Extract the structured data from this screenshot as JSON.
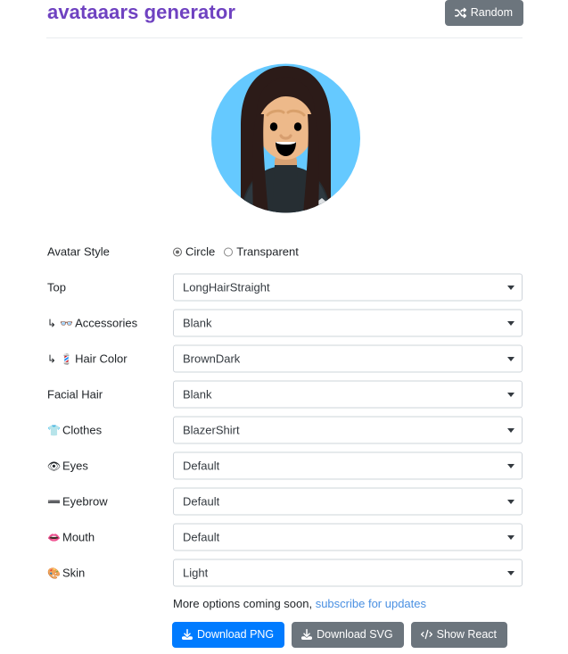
{
  "header": {
    "title": "avataaars generator",
    "random_label": "Random",
    "random_icon": "shuffle-icon"
  },
  "avatar": {
    "style": "Circle",
    "background_color": "#65c9ff",
    "skin_color": "#edb98a",
    "hair_color": "#2c1b18",
    "clothes_color": "#262e33",
    "mouth_color": "#000000",
    "eye_color": "#000000"
  },
  "form": {
    "avatar_style": {
      "label": "Avatar Style",
      "options": [
        "Circle",
        "Transparent"
      ],
      "selected": "Circle"
    },
    "fields": [
      {
        "label": "Top",
        "icon": "",
        "sub": false,
        "value": "LongHairStraight"
      },
      {
        "label": "Accessories",
        "icon": "👓",
        "icon_name": "glasses-icon",
        "sub": true,
        "value": "Blank"
      },
      {
        "label": "Hair Color",
        "icon": "💈",
        "icon_name": "hair-color-icon",
        "sub": true,
        "value": "BrownDark"
      },
      {
        "label": "Facial Hair",
        "icon": "",
        "sub": false,
        "value": "Blank"
      },
      {
        "label": "Clothes",
        "icon": "👕",
        "icon_name": "shirt-icon",
        "sub": false,
        "value": "BlazerShirt"
      },
      {
        "label": "Eyes",
        "icon": "👁",
        "icon_name": "eye-icon",
        "sub": false,
        "value": "Default"
      },
      {
        "label": "Eyebrow",
        "icon": "➖",
        "icon_name": "eyebrow-icon",
        "sub": false,
        "value": "Default"
      },
      {
        "label": "Mouth",
        "icon": "👄",
        "icon_name": "mouth-icon",
        "sub": false,
        "value": "Default"
      },
      {
        "label": "Skin",
        "icon": "🎨",
        "icon_name": "palette-icon",
        "sub": false,
        "value": "Light"
      }
    ]
  },
  "footer": {
    "more_text": "More options coming soon, ",
    "subscribe_link": "subscribe for updates",
    "buttons": [
      {
        "label": "Download PNG",
        "icon_name": "download-icon",
        "style": "primary"
      },
      {
        "label": "Download SVG",
        "icon_name": "download-icon",
        "style": "secondary"
      },
      {
        "label": "Show React",
        "icon_name": "code-icon",
        "style": "secondary"
      }
    ]
  },
  "colors": {
    "title": "#6f42c1",
    "primary": "#007bff",
    "secondary": "#6c757d",
    "link": "#4a90e2"
  }
}
